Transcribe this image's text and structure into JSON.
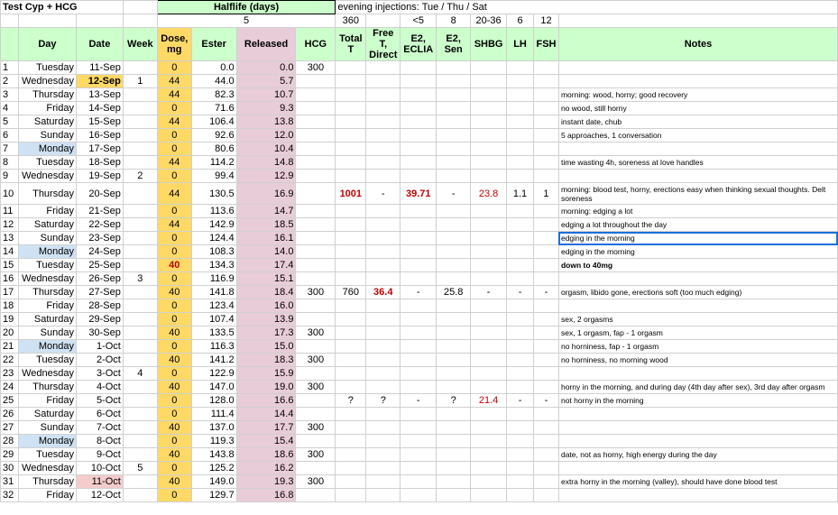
{
  "sheet": {
    "title": "Test Cyp + HCG",
    "halflife_label": "Halflife (days)",
    "halflife_value": "5",
    "injection_note": "evening injections: Tue / Thu / Sat",
    "ref_total_t": "360",
    "ref_e2_eclia": "<5",
    "ref_e2_sen": "8",
    "ref_shbg": "20-36",
    "ref_lh": "6",
    "ref_fsh": "12"
  },
  "headers": {
    "day": "Day",
    "date": "Date",
    "week": "Week",
    "dose": "Dose, mg",
    "ester": "Ester",
    "released": "Released",
    "hcg": "HCG",
    "total_t": "Total T",
    "free_t": "Free T, Direct",
    "e2_eclia": "E2, ECLIA",
    "e2_sen": "E2, Sen",
    "shbg": "SHBG",
    "lh": "LH",
    "fsh": "FSH",
    "notes": "Notes"
  },
  "rows": [
    {
      "n": "1",
      "day": "Tuesday",
      "date": "11-Sep",
      "week": "",
      "dose": "0",
      "ester": "0.0",
      "rel": "0.0",
      "hcg": "300",
      "tt": "",
      "ft": "",
      "e2e": "",
      "e2s": "",
      "shbg": "",
      "lh": "",
      "fsh": "",
      "note": ""
    },
    {
      "n": "2",
      "day": "Wednesday",
      "date": "12-Sep",
      "week": "1",
      "dose": "44",
      "ester": "44.0",
      "rel": "5.7",
      "hcg": "",
      "tt": "",
      "ft": "",
      "e2e": "",
      "e2s": "",
      "shbg": "",
      "lh": "",
      "fsh": "",
      "note": ""
    },
    {
      "n": "3",
      "day": "Thursday",
      "date": "13-Sep",
      "week": "",
      "dose": "44",
      "ester": "82.3",
      "rel": "10.7",
      "hcg": "",
      "tt": "",
      "ft": "",
      "e2e": "",
      "e2s": "",
      "shbg": "",
      "lh": "",
      "fsh": "",
      "note": "morning: wood, horny; good recovery"
    },
    {
      "n": "4",
      "day": "Friday",
      "date": "14-Sep",
      "week": "",
      "dose": "0",
      "ester": "71.6",
      "rel": "9.3",
      "hcg": "",
      "tt": "",
      "ft": "",
      "e2e": "",
      "e2s": "",
      "shbg": "",
      "lh": "",
      "fsh": "",
      "note": "no wood, still horny"
    },
    {
      "n": "5",
      "day": "Saturday",
      "date": "15-Sep",
      "week": "",
      "dose": "44",
      "ester": "106.4",
      "rel": "13.8",
      "hcg": "",
      "tt": "",
      "ft": "",
      "e2e": "",
      "e2s": "",
      "shbg": "",
      "lh": "",
      "fsh": "",
      "note": "instant date, chub"
    },
    {
      "n": "6",
      "day": "Sunday",
      "date": "16-Sep",
      "week": "",
      "dose": "0",
      "ester": "92.6",
      "rel": "12.0",
      "hcg": "",
      "tt": "",
      "ft": "",
      "e2e": "",
      "e2s": "",
      "shbg": "",
      "lh": "",
      "fsh": "",
      "note": "5 approaches, 1 conversation"
    },
    {
      "n": "7",
      "day": "Monday",
      "date": "17-Sep",
      "week": "",
      "dose": "0",
      "ester": "80.6",
      "rel": "10.4",
      "hcg": "",
      "tt": "",
      "ft": "",
      "e2e": "",
      "e2s": "",
      "shbg": "",
      "lh": "",
      "fsh": "",
      "note": ""
    },
    {
      "n": "8",
      "day": "Tuesday",
      "date": "18-Sep",
      "week": "",
      "dose": "44",
      "ester": "114.2",
      "rel": "14.8",
      "hcg": "",
      "tt": "",
      "ft": "",
      "e2e": "",
      "e2s": "",
      "shbg": "",
      "lh": "",
      "fsh": "",
      "note": "time wasting 4h, soreness at love handles"
    },
    {
      "n": "9",
      "day": "Wednesday",
      "date": "19-Sep",
      "week": "2",
      "dose": "0",
      "ester": "99.4",
      "rel": "12.9",
      "hcg": "",
      "tt": "",
      "ft": "",
      "e2e": "",
      "e2s": "",
      "shbg": "",
      "lh": "",
      "fsh": "",
      "note": ""
    },
    {
      "n": "10",
      "day": "Thursday",
      "date": "20-Sep",
      "week": "",
      "dose": "44",
      "ester": "130.5",
      "rel": "16.9",
      "hcg": "",
      "tt": "1001",
      "ft": "-",
      "e2e": "39.71",
      "e2s": "-",
      "shbg": "23.8",
      "lh": "1.1",
      "fsh": "1",
      "note": "morning: blood test, horny, erections easy when thinking sexual thoughts. Delt soreness"
    },
    {
      "n": "11",
      "day": "Friday",
      "date": "21-Sep",
      "week": "",
      "dose": "0",
      "ester": "113.6",
      "rel": "14.7",
      "hcg": "",
      "tt": "",
      "ft": "",
      "e2e": "",
      "e2s": "",
      "shbg": "",
      "lh": "",
      "fsh": "",
      "note": "morning: edging a lot"
    },
    {
      "n": "12",
      "day": "Saturday",
      "date": "22-Sep",
      "week": "",
      "dose": "44",
      "ester": "142.9",
      "rel": "18.5",
      "hcg": "",
      "tt": "",
      "ft": "",
      "e2e": "",
      "e2s": "",
      "shbg": "",
      "lh": "",
      "fsh": "",
      "note": "edging a lot throughout the day"
    },
    {
      "n": "13",
      "day": "Sunday",
      "date": "23-Sep",
      "week": "",
      "dose": "0",
      "ester": "124.4",
      "rel": "16.1",
      "hcg": "",
      "tt": "",
      "ft": "",
      "e2e": "",
      "e2s": "",
      "shbg": "",
      "lh": "",
      "fsh": "",
      "note": "edging in the morning"
    },
    {
      "n": "14",
      "day": "Monday",
      "date": "24-Sep",
      "week": "",
      "dose": "0",
      "ester": "108.3",
      "rel": "14.0",
      "hcg": "",
      "tt": "",
      "ft": "",
      "e2e": "",
      "e2s": "",
      "shbg": "",
      "lh": "",
      "fsh": "",
      "note": "edging in the morning"
    },
    {
      "n": "15",
      "day": "Tuesday",
      "date": "25-Sep",
      "week": "",
      "dose": "40",
      "ester": "134.3",
      "rel": "17.4",
      "hcg": "",
      "tt": "",
      "ft": "",
      "e2e": "",
      "e2s": "",
      "shbg": "",
      "lh": "",
      "fsh": "",
      "note": "down to 40mg"
    },
    {
      "n": "16",
      "day": "Wednesday",
      "date": "26-Sep",
      "week": "3",
      "dose": "0",
      "ester": "116.9",
      "rel": "15.1",
      "hcg": "",
      "tt": "",
      "ft": "",
      "e2e": "",
      "e2s": "",
      "shbg": "",
      "lh": "",
      "fsh": "",
      "note": ""
    },
    {
      "n": "17",
      "day": "Thursday",
      "date": "27-Sep",
      "week": "",
      "dose": "40",
      "ester": "141.8",
      "rel": "18.4",
      "hcg": "300",
      "tt": "760",
      "ft": "36.4",
      "e2e": "-",
      "e2s": "25.8",
      "shbg": "-",
      "lh": "-",
      "fsh": "-",
      "note": "orgasm, libido gone, erections soft (too much edging)"
    },
    {
      "n": "18",
      "day": "Friday",
      "date": "28-Sep",
      "week": "",
      "dose": "0",
      "ester": "123.4",
      "rel": "16.0",
      "hcg": "",
      "tt": "",
      "ft": "",
      "e2e": "",
      "e2s": "",
      "shbg": "",
      "lh": "",
      "fsh": "",
      "note": ""
    },
    {
      "n": "19",
      "day": "Saturday",
      "date": "29-Sep",
      "week": "",
      "dose": "0",
      "ester": "107.4",
      "rel": "13.9",
      "hcg": "",
      "tt": "",
      "ft": "",
      "e2e": "",
      "e2s": "",
      "shbg": "",
      "lh": "",
      "fsh": "",
      "note": "sex, 2 orgasms"
    },
    {
      "n": "20",
      "day": "Sunday",
      "date": "30-Sep",
      "week": "",
      "dose": "40",
      "ester": "133.5",
      "rel": "17.3",
      "hcg": "300",
      "tt": "",
      "ft": "",
      "e2e": "",
      "e2s": "",
      "shbg": "",
      "lh": "",
      "fsh": "",
      "note": "sex, 1 orgasm, fap - 1 orgasm"
    },
    {
      "n": "21",
      "day": "Monday",
      "date": "1-Oct",
      "week": "",
      "dose": "0",
      "ester": "116.3",
      "rel": "15.0",
      "hcg": "",
      "tt": "",
      "ft": "",
      "e2e": "",
      "e2s": "",
      "shbg": "",
      "lh": "",
      "fsh": "",
      "note": "no horniness, fap - 1 orgasm"
    },
    {
      "n": "22",
      "day": "Tuesday",
      "date": "2-Oct",
      "week": "",
      "dose": "40",
      "ester": "141.2",
      "rel": "18.3",
      "hcg": "300",
      "tt": "",
      "ft": "",
      "e2e": "",
      "e2s": "",
      "shbg": "",
      "lh": "",
      "fsh": "",
      "note": "no horniness, no morning wood"
    },
    {
      "n": "23",
      "day": "Wednesday",
      "date": "3-Oct",
      "week": "4",
      "dose": "0",
      "ester": "122.9",
      "rel": "15.9",
      "hcg": "",
      "tt": "",
      "ft": "",
      "e2e": "",
      "e2s": "",
      "shbg": "",
      "lh": "",
      "fsh": "",
      "note": ""
    },
    {
      "n": "24",
      "day": "Thursday",
      "date": "4-Oct",
      "week": "",
      "dose": "40",
      "ester": "147.0",
      "rel": "19.0",
      "hcg": "300",
      "tt": "",
      "ft": "",
      "e2e": "",
      "e2s": "",
      "shbg": "",
      "lh": "",
      "fsh": "",
      "note": "horny in the morning, and during day (4th day after sex), 3rd day after orgasm"
    },
    {
      "n": "25",
      "day": "Friday",
      "date": "5-Oct",
      "week": "",
      "dose": "0",
      "ester": "128.0",
      "rel": "16.6",
      "hcg": "",
      "tt": "?",
      "ft": "?",
      "e2e": "-",
      "e2s": "?",
      "shbg": "21.4",
      "lh": "-",
      "fsh": "-",
      "note": "not horny in the morning"
    },
    {
      "n": "26",
      "day": "Saturday",
      "date": "6-Oct",
      "week": "",
      "dose": "0",
      "ester": "111.4",
      "rel": "14.4",
      "hcg": "",
      "tt": "",
      "ft": "",
      "e2e": "",
      "e2s": "",
      "shbg": "",
      "lh": "",
      "fsh": "",
      "note": ""
    },
    {
      "n": "27",
      "day": "Sunday",
      "date": "7-Oct",
      "week": "",
      "dose": "40",
      "ester": "137.0",
      "rel": "17.7",
      "hcg": "300",
      "tt": "",
      "ft": "",
      "e2e": "",
      "e2s": "",
      "shbg": "",
      "lh": "",
      "fsh": "",
      "note": ""
    },
    {
      "n": "28",
      "day": "Monday",
      "date": "8-Oct",
      "week": "",
      "dose": "0",
      "ester": "119.3",
      "rel": "15.4",
      "hcg": "",
      "tt": "",
      "ft": "",
      "e2e": "",
      "e2s": "",
      "shbg": "",
      "lh": "",
      "fsh": "",
      "note": ""
    },
    {
      "n": "29",
      "day": "Tuesday",
      "date": "9-Oct",
      "week": "",
      "dose": "40",
      "ester": "143.8",
      "rel": "18.6",
      "hcg": "300",
      "tt": "",
      "ft": "",
      "e2e": "",
      "e2s": "",
      "shbg": "",
      "lh": "",
      "fsh": "",
      "note": "date, not as horny, high energy during the day"
    },
    {
      "n": "30",
      "day": "Wednesday",
      "date": "10-Oct",
      "week": "5",
      "dose": "0",
      "ester": "125.2",
      "rel": "16.2",
      "hcg": "",
      "tt": "",
      "ft": "",
      "e2e": "",
      "e2s": "",
      "shbg": "",
      "lh": "",
      "fsh": "",
      "note": ""
    },
    {
      "n": "31",
      "day": "Thursday",
      "date": "11-Oct",
      "week": "",
      "dose": "40",
      "ester": "149.0",
      "rel": "19.3",
      "hcg": "300",
      "tt": "",
      "ft": "",
      "e2e": "",
      "e2s": "",
      "shbg": "",
      "lh": "",
      "fsh": "",
      "note": "extra horny in the morning (valley), should have done blood test"
    },
    {
      "n": "32",
      "day": "Friday",
      "date": "12-Oct",
      "week": "",
      "dose": "0",
      "ester": "129.7",
      "rel": "16.8",
      "hcg": "",
      "tt": "",
      "ft": "",
      "e2e": "",
      "e2s": "",
      "shbg": "",
      "lh": "",
      "fsh": "",
      "note": ""
    }
  ],
  "colors": {
    "header_green": "#ccffcc",
    "dose_yellow": "#ffd966",
    "released_pink": "#e8ccd7",
    "monday_blue": "#cfe2f3",
    "lab_red": "#c00000"
  }
}
